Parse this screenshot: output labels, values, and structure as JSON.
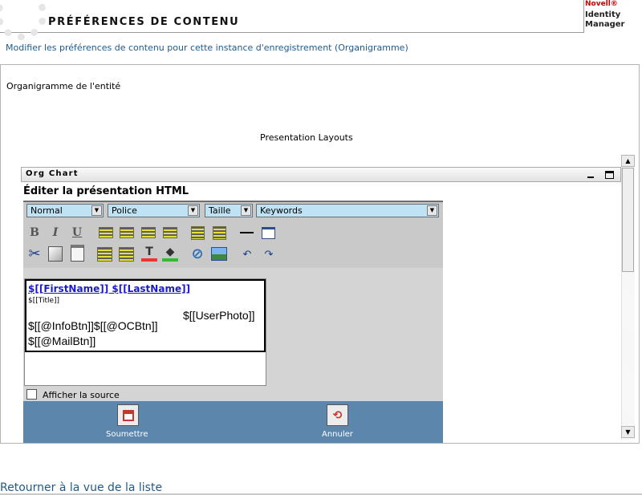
{
  "header": {
    "title": "PRÉFÉRENCES DE CONTENU",
    "brand": {
      "company": "Novell®",
      "line1": "Identity",
      "line2": "Manager"
    }
  },
  "subtitle": "Modifier les préférences de contenu pour cette instance d'enregistrement (Organigramme)",
  "entity_label": "Organigramme de l'entité",
  "layouts_label": "Presentation Layouts",
  "panel": {
    "title": "Org Chart",
    "editor_title": "Éditer la présentation HTML",
    "selects": {
      "format": "Normal",
      "font": "Police",
      "size": "Taille",
      "keywords": "Keywords"
    },
    "toolbar_icons": [
      "bold-icon",
      "italic-icon",
      "underline-icon",
      "align-left-icon",
      "align-center-icon",
      "align-right-icon",
      "justify-icon",
      "ordered-list-icon",
      "unordered-list-icon",
      "horizontal-rule-icon",
      "table-icon",
      "cut-icon",
      "copy-icon",
      "paste-icon",
      "outdent-icon",
      "indent-icon",
      "text-color-icon",
      "highlight-color-icon",
      "link-icon",
      "image-icon",
      "undo-icon",
      "redo-icon"
    ],
    "content": {
      "name": "$[[FirstName]] $[[LastName]]",
      "title": "$[[Title]]",
      "photo": "$[[UserPhoto]]",
      "buttons": "$[[@InfoBtn]]$[[@OCBtn]]",
      "mail": "$[[@MailBtn]]"
    },
    "show_source_label": "Afficher la source",
    "submit_label": "Soumettre",
    "cancel_label": "Annuler"
  },
  "back_link": "Retourner à la vue de la liste"
}
